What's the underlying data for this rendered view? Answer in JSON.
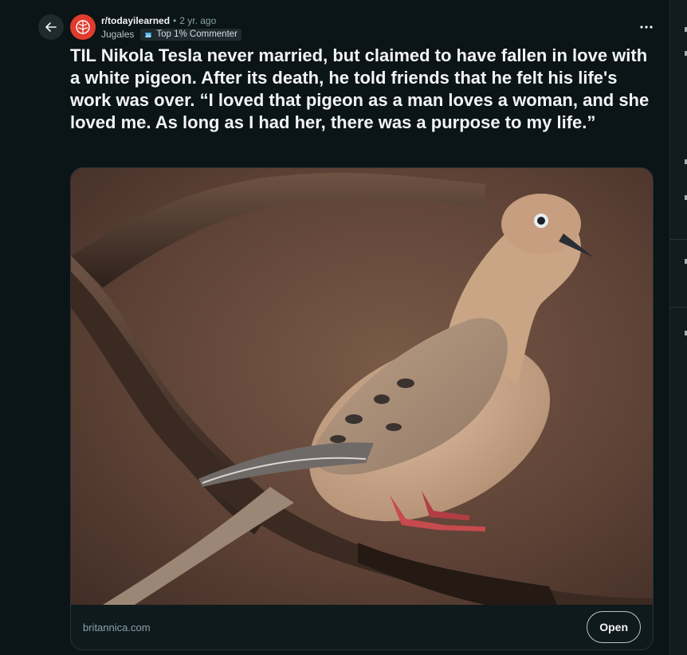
{
  "post": {
    "subreddit": "r/todayilearned",
    "separator": "•",
    "time_ago": "2 yr. ago",
    "author": "Jugales",
    "flair": "Top 1% Commenter",
    "title": "TIL Nikola Tesla never married, but claimed to have fallen in love with a white pigeon. After its death, he told friends that he felt his life's work was over. “I loved that pigeon as a man loves a woman, and she loved me. As long as I had her, there was a purpose to my life.”"
  },
  "link_card": {
    "image_subject": "mourning dove perched on a branch",
    "domain": "britannica.com",
    "open_label": "Open"
  },
  "icons": {
    "back": "back-arrow-icon",
    "more": "more-options-icon",
    "subreddit": "subreddit-brain-icon",
    "flair": "commenter-badge-icon"
  },
  "colors": {
    "background": "#0b1416",
    "subreddit_avatar": "#e03b2e",
    "muted_text": "#8ba2ad"
  }
}
